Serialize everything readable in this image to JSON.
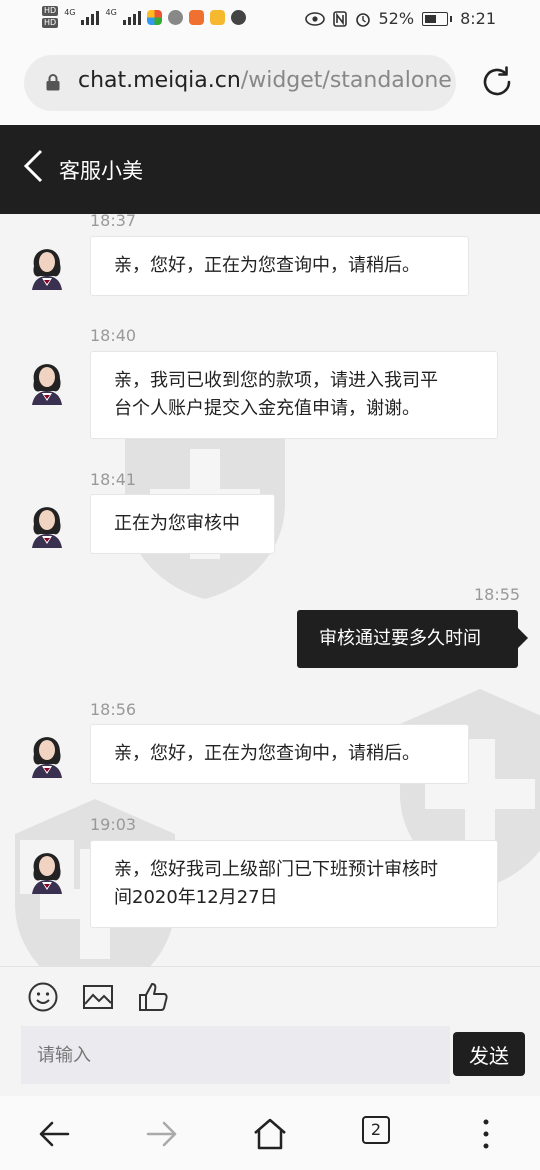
{
  "status_bar": {
    "battery": "52%",
    "time": "8:21",
    "net1": "4G",
    "net2": "4G",
    "hd": "HD"
  },
  "browser": {
    "url_host": "chat.meiqia.cn",
    "url_path": "/widget/standalone"
  },
  "header": {
    "title": "客服小美"
  },
  "messages": [
    {
      "time": "18:37",
      "from": "agent",
      "lines": [
        "亲，您好，正在为您查询中，请稍后。"
      ]
    },
    {
      "time": "18:40",
      "from": "agent",
      "lines": [
        "亲，我司已收到您的款项，请进入我司平",
        "台个人账户提交入金充值申请，谢谢。"
      ]
    },
    {
      "time": "18:41",
      "from": "agent",
      "lines": [
        "正在为您审核中"
      ]
    },
    {
      "time": "18:55",
      "from": "user",
      "lines": [
        "审核通过要多久时间"
      ]
    },
    {
      "time": "18:56",
      "from": "agent",
      "lines": [
        "亲，您好，正在为您查询中，请稍后。"
      ]
    },
    {
      "time": "19:03",
      "from": "agent",
      "lines": [
        "亲，您好我司上级部门已下班预计审核时",
        "间2020年12月27日"
      ]
    }
  ],
  "composer": {
    "placeholder": "请输入",
    "send_label": "发送"
  },
  "toolbar_icons": [
    "emoji-icon",
    "image-icon",
    "thumbs-up-icon"
  ],
  "nav": {
    "tab_count": "2"
  },
  "colors": {
    "dark": "#1f1f1f",
    "bg": "#f4f4f5",
    "bubble": "#ffffff"
  }
}
